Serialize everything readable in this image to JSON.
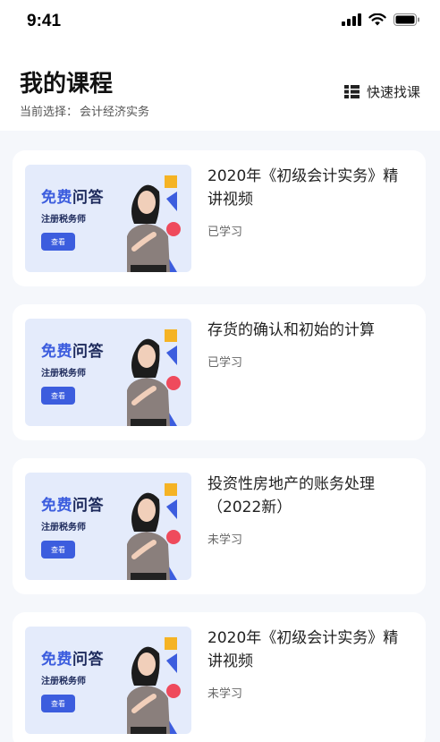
{
  "status_bar": {
    "time": "9:41",
    "icons": [
      "signal-icon",
      "wifi-icon",
      "battery-icon"
    ]
  },
  "header": {
    "title": "我的课程",
    "subtitle_label": "当前选择：",
    "subtitle_value": "会计经济实务",
    "quick_find_icon": "grid-list-icon",
    "quick_find_label": "快速找课"
  },
  "thumbnail": {
    "title_part1": "免费",
    "title_part2": "问答",
    "subtitle": "注册税务师",
    "button": "查看"
  },
  "courses": [
    {
      "title": "2020年《初级会计实务》精讲视频",
      "status": "已学习"
    },
    {
      "title": "存货的确认和初始的计算",
      "status": "已学习"
    },
    {
      "title": "投资性房地产的账务处理（2022新）",
      "status": "未学习"
    },
    {
      "title": "2020年《初级会计实务》精讲视频",
      "status": "未学习"
    }
  ],
  "colors": {
    "accent": "#3c5dde",
    "background": "#f5f7fb",
    "thumb_bg": "#e4ebfb"
  }
}
